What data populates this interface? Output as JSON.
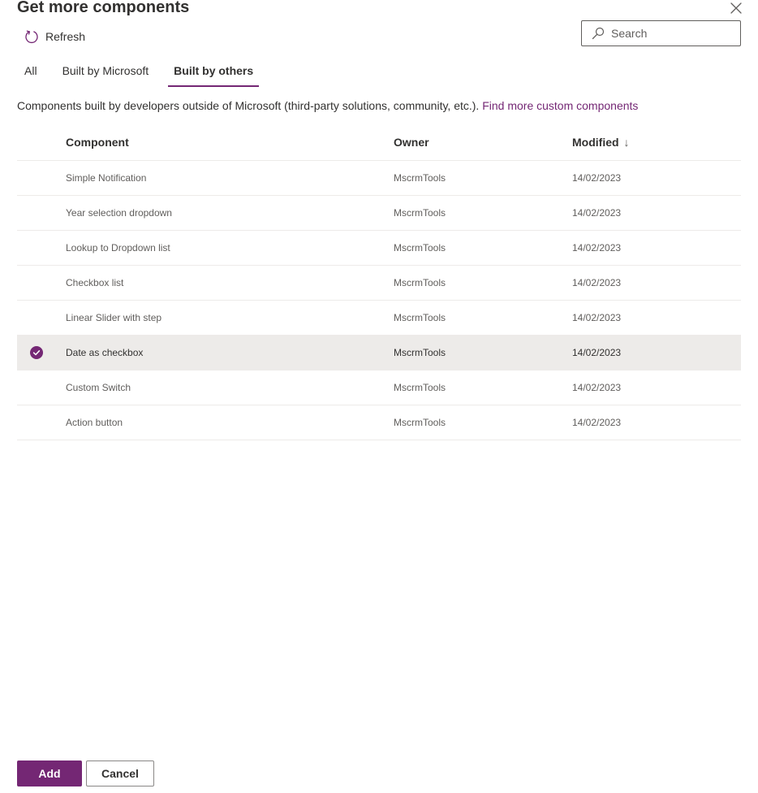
{
  "panel": {
    "title": "Get more components",
    "close_icon": "close-icon"
  },
  "toolbar": {
    "refresh_label": "Refresh",
    "refresh_icon": "refresh-icon"
  },
  "search": {
    "placeholder": "Search",
    "icon": "search-icon"
  },
  "tabs": [
    {
      "label": "All",
      "active": false
    },
    {
      "label": "Built by Microsoft",
      "active": false
    },
    {
      "label": "Built by others",
      "active": true
    }
  ],
  "description": {
    "text": "Components built by developers outside of Microsoft (third-party solutions, community, etc.).",
    "link_text": "Find more custom components"
  },
  "grid": {
    "columns": {
      "component": "Component",
      "owner": "Owner",
      "modified": "Modified",
      "modified_sort_icon": "arrow-down-icon"
    },
    "rows": [
      {
        "component": "Simple Notification",
        "owner": "MscrmTools",
        "modified": "14/02/2023",
        "selected": false
      },
      {
        "component": "Year selection dropdown",
        "owner": "MscrmTools",
        "modified": "14/02/2023",
        "selected": false
      },
      {
        "component": "Lookup to Dropdown list",
        "owner": "MscrmTools",
        "modified": "14/02/2023",
        "selected": false
      },
      {
        "component": "Checkbox list",
        "owner": "MscrmTools",
        "modified": "14/02/2023",
        "selected": false
      },
      {
        "component": "Linear Slider with step",
        "owner": "MscrmTools",
        "modified": "14/02/2023",
        "selected": false
      },
      {
        "component": "Date as checkbox",
        "owner": "MscrmTools",
        "modified": "14/02/2023",
        "selected": true
      },
      {
        "component": "Custom Switch",
        "owner": "MscrmTools",
        "modified": "14/02/2023",
        "selected": false
      },
      {
        "component": "Action button",
        "owner": "MscrmTools",
        "modified": "14/02/2023",
        "selected": false
      }
    ]
  },
  "footer": {
    "add_label": "Add",
    "cancel_label": "Cancel"
  },
  "colors": {
    "accent": "#742774",
    "selected_row": "#edebe9",
    "divider": "#edebe9",
    "text": "#323130",
    "secondary_text": "#605e5c"
  }
}
